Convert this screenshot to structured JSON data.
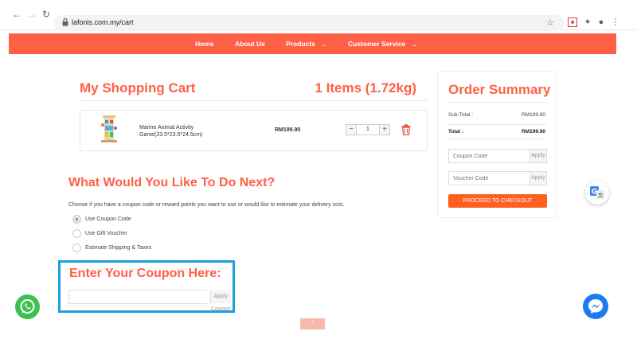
{
  "browser": {
    "url": "lafonis.com.my/cart"
  },
  "nav": {
    "items": [
      {
        "label": "Home",
        "dropdown": false
      },
      {
        "label": "About Us",
        "dropdown": false
      },
      {
        "label": "Products",
        "dropdown": true
      },
      {
        "label": "Customer Service",
        "dropdown": true
      }
    ]
  },
  "cart": {
    "title": "My Shopping Cart",
    "count": "1 Items (1.72kg)",
    "items": [
      {
        "name": "Marine Animal Activity Game(23.5*23.5*24.5cm)",
        "price": "RM199.90",
        "qty": "1"
      }
    ]
  },
  "summary": {
    "title": "Order Summary",
    "subtotal_label": "Sub-Total :",
    "subtotal_value": "RM199.90",
    "total_label": "Total :",
    "total_value": "RM199.90",
    "coupon_placeholder": "Coupon Code",
    "voucher_placeholder": "Voucher Code",
    "apply_label": "Apply",
    "checkout_label": "PROCEED TO CHECKOUT"
  },
  "next": {
    "title": "What Would You Like To Do Next?",
    "description": "Choose if you have a coupon code or reward points you want to use or would like to estimate your delivery cost.",
    "options": [
      {
        "label": "Use Coupon Code",
        "selected": true
      },
      {
        "label": "Use Gift Voucher",
        "selected": false
      },
      {
        "label": "Estimate Shipping & Taxes",
        "selected": false
      }
    ]
  },
  "coupon": {
    "title": "Enter Your Coupon Here:",
    "apply_label": "Apply Coupon"
  },
  "colors": {
    "brand": "#ff5f45",
    "highlight": "#1ca0e4"
  }
}
